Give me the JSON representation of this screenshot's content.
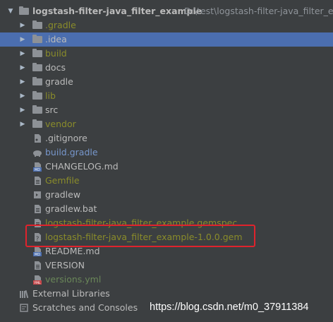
{
  "colors": {
    "background": "#3c3f41",
    "selection": "#4b6eaf",
    "default_text": "#bbbbbb",
    "ignored_text": "#8a8c2a",
    "unversioned_text": "#6a8759",
    "link_blue": "#7797cc",
    "highlight_box": "#e0232c"
  },
  "tree": {
    "root": {
      "label": "logstash-filter-java_filter_example",
      "path": "D:\\test\\logstash-filter-java_filter_exar"
    },
    "items": [
      {
        "label": ".gradle",
        "kind": "folder",
        "color": "#8a8c2a",
        "expandable": true
      },
      {
        "label": ".idea",
        "kind": "folder",
        "color": "#bbbbbb",
        "expandable": true,
        "selected": true
      },
      {
        "label": "build",
        "kind": "folder",
        "color": "#8a8c2a",
        "expandable": true
      },
      {
        "label": "docs",
        "kind": "folder",
        "color": "#bbbbbb",
        "expandable": true
      },
      {
        "label": "gradle",
        "kind": "folder",
        "color": "#bbbbbb",
        "expandable": true
      },
      {
        "label": "lib",
        "kind": "folder",
        "color": "#8a8c2a",
        "expandable": true
      },
      {
        "label": "src",
        "kind": "folder",
        "color": "#bbbbbb",
        "expandable": true
      },
      {
        "label": "vendor",
        "kind": "folder",
        "color": "#8a8c2a",
        "expandable": true
      },
      {
        "label": ".gitignore",
        "kind": "file",
        "icon": "gitignore-file-icon",
        "color": "#bbbbbb"
      },
      {
        "label": "build.gradle",
        "kind": "file",
        "icon": "gradle-elephant-icon",
        "color": "#7797cc"
      },
      {
        "label": "CHANGELOG.md",
        "kind": "file",
        "icon": "markdown-file-icon",
        "color": "#bbbbbb"
      },
      {
        "label": "Gemfile",
        "kind": "file",
        "icon": "text-file-icon",
        "color": "#8a8c2a"
      },
      {
        "label": "gradlew",
        "kind": "file",
        "icon": "shell-script-icon",
        "color": "#bbbbbb"
      },
      {
        "label": "gradlew.bat",
        "kind": "file",
        "icon": "text-file-icon",
        "color": "#bbbbbb"
      },
      {
        "label": "logstash-filter-java_filter_example.gemspec",
        "kind": "file",
        "icon": "text-file-icon",
        "color": "#8a8c2a"
      },
      {
        "label": "logstash-filter-java_filter_example-1.0.0.gem",
        "kind": "file",
        "icon": "unknown-file-icon",
        "color": "#8a8c2a"
      },
      {
        "label": "README.md",
        "kind": "file",
        "icon": "markdown-file-icon",
        "color": "#bbbbbb"
      },
      {
        "label": "VERSION",
        "kind": "file",
        "icon": "text-file-icon",
        "color": "#bbbbbb"
      },
      {
        "label": "versions.yml",
        "kind": "file",
        "icon": "yaml-file-icon",
        "color": "#6a8759"
      }
    ],
    "external_libraries": "External Libraries",
    "scratches": "Scratches and Consoles"
  },
  "watermark": "https://blog.csdn.net/m0_37911384",
  "icon_text": {
    "md": "MD",
    "yml": "YML",
    "unknown": "?"
  }
}
